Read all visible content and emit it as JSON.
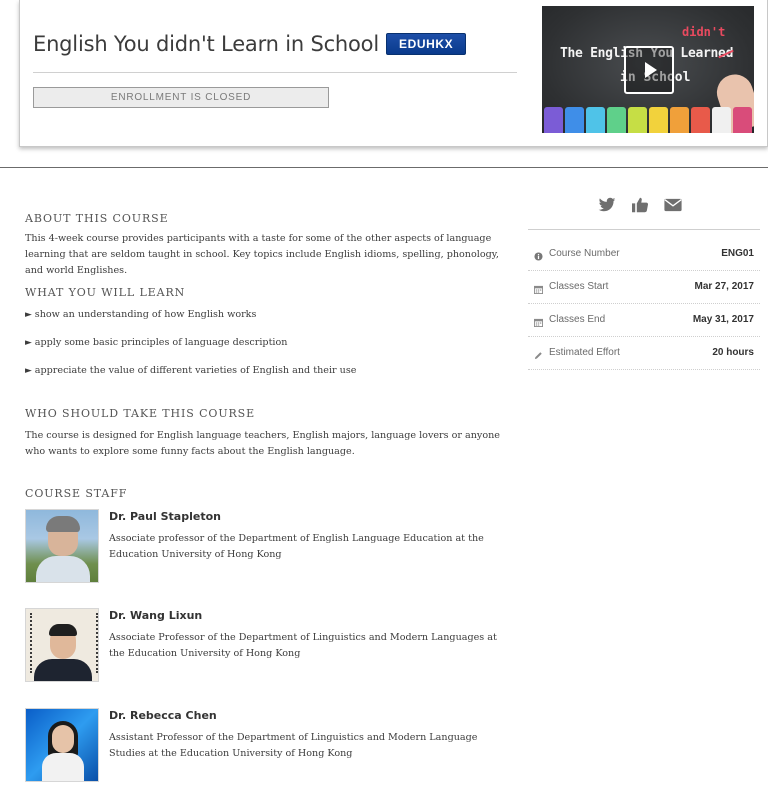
{
  "header": {
    "course_title": "English You didn't Learn in School",
    "org_badge": "EDUHKX",
    "enroll_status": "ENROLLMENT IS CLOSED",
    "video_thumbnail": {
      "line1": "The English You Learned",
      "line2": "in School",
      "inserted_word": "didn't",
      "play_icon": "play-icon",
      "chalk_colors": [
        "#7b5cd6",
        "#3f8ee8",
        "#4fc3e8",
        "#5fd08a",
        "#c6de45",
        "#f2d23c",
        "#f0a03a",
        "#e85a4a",
        "#f0f0f0",
        "#d94c7a"
      ]
    }
  },
  "about": {
    "heading": "ABOUT THIS COURSE",
    "text": "This 4-week course provides participants with a taste for some of the other aspects of language learning that are seldom taught in school. Key topics include English idioms, spelling, phonology, and world Englishes."
  },
  "learn": {
    "heading": "WHAT YOU WILL LEARN",
    "items": [
      "show an understanding of how English works",
      "apply some basic principles of language description",
      "appreciate the value of different varieties of English and their use"
    ]
  },
  "who": {
    "heading": "WHO SHOULD TAKE THIS COURSE",
    "text": "The course is designed for English language teachers, English majors, language lovers or anyone who wants to explore some funny facts about the English language."
  },
  "staff": {
    "heading": "COURSE STAFF",
    "members": [
      {
        "name": "Dr. Paul Stapleton",
        "bio": "Associate professor of the Department of English Language Education at the Education University of Hong Kong"
      },
      {
        "name": "Dr. Wang Lixun",
        "bio": "Associate Professor of the Department of Linguistics and Modern Languages at the Education University of Hong Kong"
      },
      {
        "name": "Dr. Rebecca Chen",
        "bio": "Assistant Professor of the Department of Linguistics and Modern Language Studies at the Education University of Hong Kong"
      }
    ]
  },
  "sidebar": {
    "share_icons": [
      "twitter-icon",
      "thumbs-up-icon",
      "email-icon"
    ],
    "facts": [
      {
        "icon": "info-icon",
        "label": "Course Number",
        "value": "ENG01"
      },
      {
        "icon": "calendar-icon",
        "label": "Classes Start",
        "value": "Mar 27, 2017"
      },
      {
        "icon": "calendar-icon",
        "label": "Classes End",
        "value": "May 31, 2017"
      },
      {
        "icon": "pencil-icon",
        "label": "Estimated Effort",
        "value": "20 hours"
      }
    ]
  },
  "colors": {
    "badge_blue": "#0a3a8c",
    "text": "#3c3c3c",
    "icon_gray": "#6f6f6f"
  }
}
